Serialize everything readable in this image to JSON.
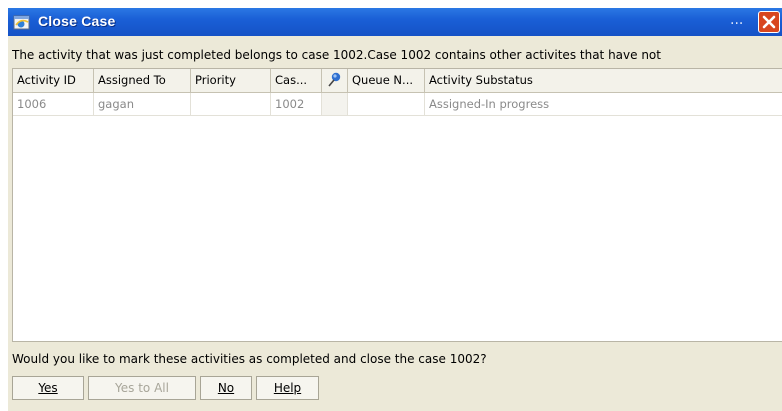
{
  "window": {
    "title": "Close Case",
    "title_ellipsis": "...",
    "close_glyph": "✕"
  },
  "message": "The activity that was just completed belongs to case 1002.Case 1002 contains other activites that have not",
  "grid": {
    "columns": [
      "Activity ID",
      "Assigned To",
      "Priority",
      "Cas...",
      "",
      "Queue N...",
      "Activity Substatus"
    ],
    "pin_icon": "pin-icon",
    "rows": [
      [
        "1006",
        "gagan",
        "",
        "1002",
        "",
        "",
        "Assigned-In progress"
      ]
    ]
  },
  "question": "Would you like to mark these activities as completed and close the case 1002?",
  "buttons": {
    "yes": "Yes",
    "yes_to_all": "Yes to All",
    "no": "No",
    "help": "Help"
  },
  "colors": {
    "titlebar": "#1a5fd6",
    "close_button": "#d8461f",
    "dialog_background": "#ece9d8"
  }
}
